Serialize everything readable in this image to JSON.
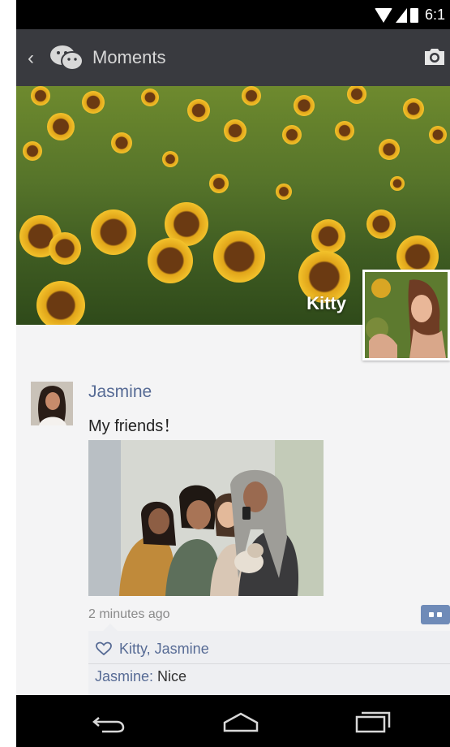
{
  "status_bar": {
    "time": "6:1"
  },
  "action_bar": {
    "title": "Moments"
  },
  "cover": {
    "owner_name": "Kitty"
  },
  "post": {
    "author": "Jasmine",
    "text": "My friends！",
    "time_ago": "2 minutes ago",
    "likes": "Kitty, Jasmine",
    "comments": [
      {
        "author": "Jasmine",
        "separator": ":",
        "text": " Nice"
      }
    ]
  },
  "colors": {
    "action_bar_bg": "#393a3f",
    "link_blue": "#576b95",
    "comment_button": "#6f8bb8"
  },
  "icons": [
    "back-chevron-icon",
    "wechat-logo-icon",
    "camera-icon",
    "heart-icon",
    "comment-icon",
    "nav-back-icon",
    "nav-home-icon",
    "nav-recents-icon"
  ]
}
